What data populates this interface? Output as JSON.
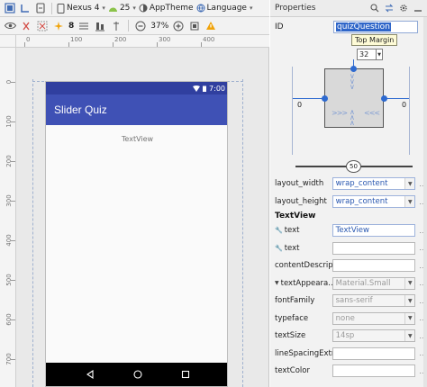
{
  "toolbar1": {
    "device": "Nexus 4",
    "api": "25",
    "theme": "AppTheme",
    "language": "Language"
  },
  "toolbar2": {
    "margin_value": "8",
    "zoom": "37%"
  },
  "rulers": {
    "top": [
      "0",
      "100",
      "200",
      "300",
      "400"
    ],
    "left": [
      "0",
      "100",
      "200",
      "300",
      "400",
      "500",
      "600",
      "700"
    ]
  },
  "phone": {
    "status_time": "7:00",
    "app_title": "Slider Quiz",
    "textview": "TextView"
  },
  "properties": {
    "title": "Properties",
    "id_label": "ID",
    "id_value": "quizQuestion",
    "tooltip": "Top Margin",
    "top_margin": "32",
    "left_margin": "0",
    "right_margin": "0",
    "bias": "50",
    "layout_width_label": "layout_width",
    "layout_width_value": "wrap_content",
    "layout_height_label": "layout_height",
    "layout_height_value": "wrap_content",
    "section": "TextView",
    "rows": [
      {
        "label": "text",
        "value": "TextView",
        "style": "blue"
      },
      {
        "label": "text",
        "value": "",
        "style": "plain"
      },
      {
        "label": "contentDescrip…",
        "value": "",
        "style": "plain"
      },
      {
        "label": "textAppeara…",
        "value": "Material.Small",
        "style": "gray"
      },
      {
        "label": "fontFamily",
        "value": "sans-serif",
        "style": "gray"
      },
      {
        "label": "typeface",
        "value": "none",
        "style": "gray"
      },
      {
        "label": "textSize",
        "value": "14sp",
        "style": "gray"
      },
      {
        "label": "lineSpacingExtra",
        "value": "",
        "style": "plain"
      },
      {
        "label": "textColor",
        "value": "",
        "style": "plain"
      }
    ]
  },
  "colors": {
    "statusbar": "#303f9f",
    "appbar": "#3f51b5",
    "accent": "#2e6ad0"
  }
}
